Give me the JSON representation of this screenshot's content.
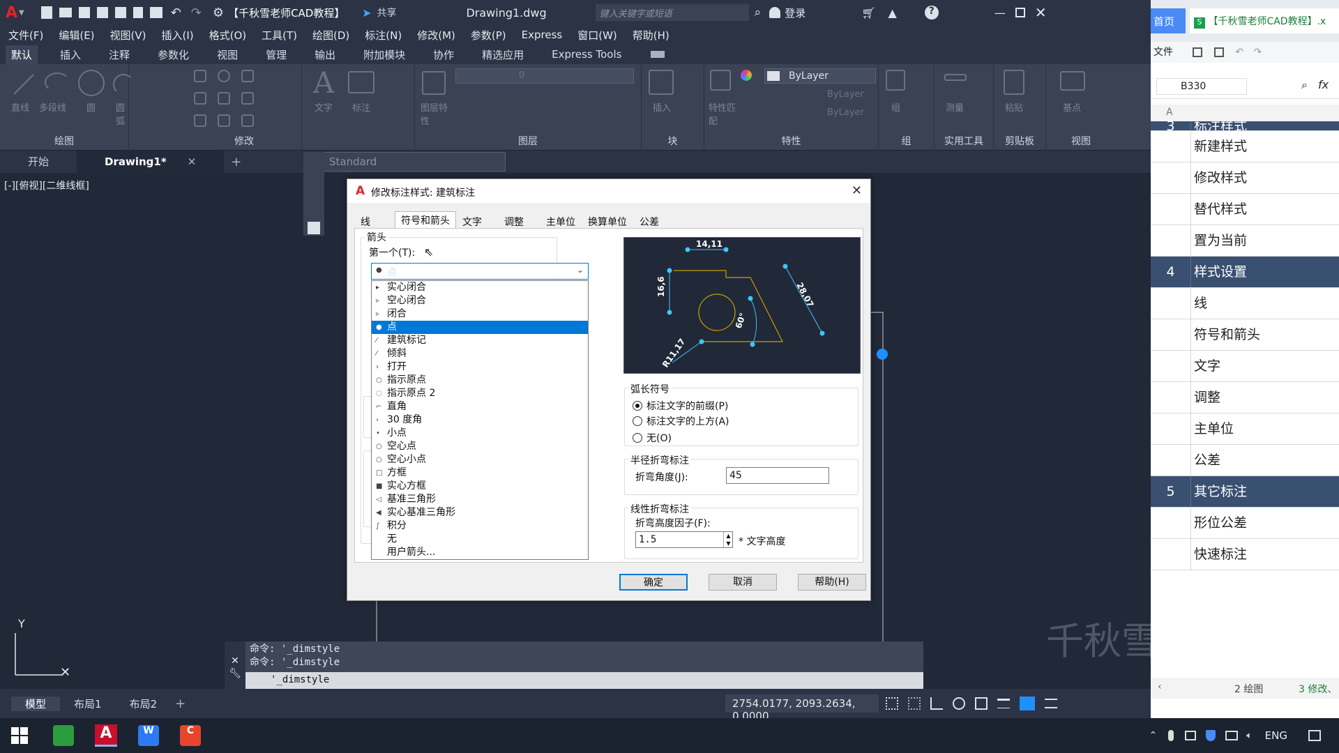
{
  "titlebar": {
    "qa_title": "【千秋雪老师CAD教程】",
    "share": "共享",
    "file": "Drawing1.dwg",
    "search_placeholder": "键入关键字或短语",
    "login": "登录"
  },
  "menu": [
    "文件(F)",
    "编辑(E)",
    "视图(V)",
    "插入(I)",
    "格式(O)",
    "工具(T)",
    "绘图(D)",
    "标注(N)",
    "修改(M)",
    "参数(P)",
    "Express",
    "窗口(W)",
    "帮助(H)"
  ],
  "ribbon_tabs": [
    "默认",
    "插入",
    "注释",
    "参数化",
    "视图",
    "管理",
    "输出",
    "附加模块",
    "协作",
    "精选应用",
    "Express Tools"
  ],
  "ribbon": {
    "draw_tools": [
      "直线",
      "多段线",
      "圆",
      "圆弧"
    ],
    "text": "文字",
    "dimension": "标注",
    "layer_props": "图层特性",
    "insert": "插入",
    "match": "特性匹配",
    "group": "组",
    "measure": "测量",
    "paste": "粘贴",
    "base": "基点",
    "bylayer": "ByLayer",
    "layer_val": "0",
    "panels": [
      "绘图",
      "修改",
      "图层",
      "块",
      "特性",
      "组",
      "实用工具",
      "剪贴板",
      "视图"
    ]
  },
  "doc_tabs": [
    "开始",
    "Drawing1*"
  ],
  "viewport_label": "[-][俯视][二维线框]",
  "text_style": "Standard",
  "command": {
    "lines": [
      "命令: '_dimstyle",
      "命令: '_dimstyle"
    ],
    "input": "'_dimstyle"
  },
  "status": {
    "layouts": [
      "模型",
      "布局1",
      "布局2"
    ],
    "coords": "2754.0177, 2093.2634, 0.0000"
  },
  "dialog": {
    "title": "修改标注样式: 建筑标注",
    "tabs": [
      "线",
      "符号和箭头",
      "文字",
      "调整",
      "主单位",
      "换算单位",
      "公差"
    ],
    "arrows_group": "箭头",
    "first_label": "第一个(T):",
    "first_value": "点",
    "options": [
      "实心闭合",
      "空心闭合",
      "闭合",
      "点",
      "建筑标记",
      "倾斜",
      "打开",
      "指示原点",
      "指示原点 2",
      "直角",
      "30 度角",
      "小点",
      "空心点",
      "空心小点",
      "方框",
      "实心方框",
      "基准三角形",
      "实心基准三角形",
      "积分",
      "无",
      "用户箭头..."
    ],
    "option_marks": [
      "▸",
      "▹",
      "▹",
      "●",
      "⁄",
      "⁄",
      "›",
      "○",
      "◌",
      "⌐",
      "›",
      "•",
      "○",
      "○",
      "□",
      "■",
      "◁",
      "◀",
      "∫",
      "",
      ""
    ],
    "selected_index": 3,
    "preview": {
      "dim_top": "14,11",
      "dim_left": "16,6",
      "dim_angle": "60°",
      "dim_right": "28,07",
      "dim_radius": "R11,17"
    },
    "arc_group": "弧长符号",
    "arc_options": [
      "标注文字的前缀(P)",
      "标注文字的上方(A)",
      "无(O)"
    ],
    "radius_group": "半径折弯标注",
    "jog_angle_label": "折弯角度(J):",
    "jog_angle": "45",
    "linear_group": "线性折弯标注",
    "jog_factor_label": "折弯高度因子(F):",
    "jog_factor": "1.5",
    "text_height": "* 文字高度",
    "ok": "确定",
    "cancel": "取消",
    "help": "帮助(H)"
  },
  "right_pane": {
    "tab1": "首页",
    "tab2": "【千秋雪老师CAD教程】.x",
    "file_menu": "文件",
    "cell": "B330",
    "fx": "fx",
    "col": "A",
    "rows": [
      {
        "n": "3",
        "t": "标注样式",
        "h": true
      },
      {
        "n": "",
        "t": "新建样式"
      },
      {
        "n": "",
        "t": "修改样式"
      },
      {
        "n": "",
        "t": "替代样式"
      },
      {
        "n": "",
        "t": "置为当前"
      },
      {
        "n": "4",
        "t": "样式设置",
        "h": true
      },
      {
        "n": "",
        "t": "线"
      },
      {
        "n": "",
        "t": "符号和箭头"
      },
      {
        "n": "",
        "t": "文字"
      },
      {
        "n": "",
        "t": "调整"
      },
      {
        "n": "",
        "t": "主单位"
      },
      {
        "n": "",
        "t": "公差"
      },
      {
        "n": "5",
        "t": "其它标注",
        "h": true
      },
      {
        "n": "",
        "t": "形位公差"
      },
      {
        "n": "",
        "t": "快速标注"
      }
    ],
    "sheet1": "2 绘图",
    "sheet2": "3 修改、"
  },
  "taskbar": {
    "lang": "ENG"
  },
  "watermark": "千秋雪"
}
